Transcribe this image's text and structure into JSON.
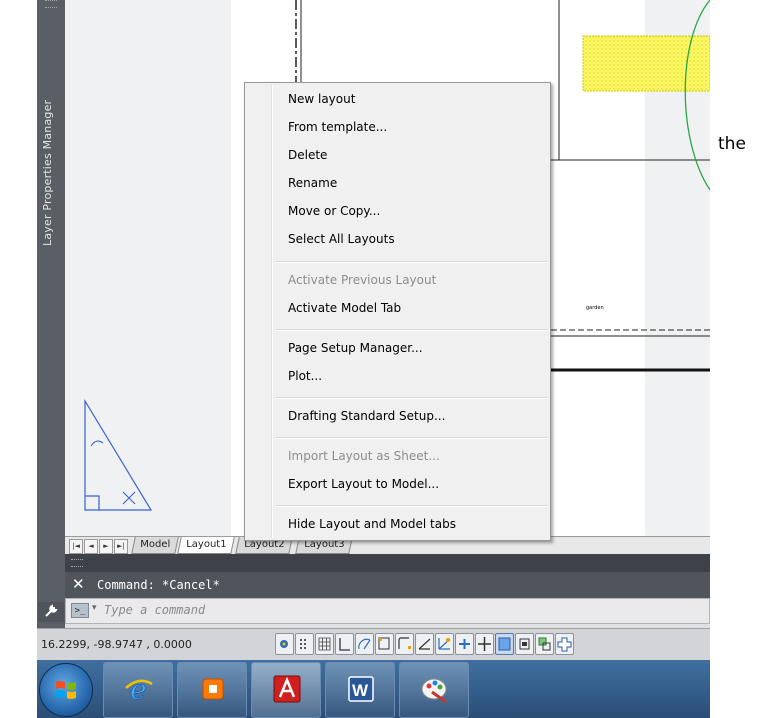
{
  "palette": {
    "title": "Layer Properties Manager"
  },
  "drawing": {
    "small_label": "garden"
  },
  "layout_tabs": {
    "nav": [
      "|◄",
      "◄",
      "►",
      "►|"
    ],
    "tabs": [
      {
        "label": "Model",
        "active": false
      },
      {
        "label": "Layout1",
        "active": true
      },
      {
        "label": "Layout2",
        "active": false
      },
      {
        "label": "Layout3",
        "active": false
      }
    ]
  },
  "command": {
    "history": "Command: *Cancel*",
    "prompt_glyph": ">_",
    "placeholder": "Type a command"
  },
  "status": {
    "coordinates": "16.2299,  -98.9747  , 0.0000"
  },
  "context_menu": {
    "items": [
      {
        "label": "New layout",
        "disabled": false
      },
      {
        "label": "From template...",
        "disabled": false
      },
      {
        "label": "Delete",
        "disabled": false
      },
      {
        "label": "Rename",
        "disabled": false
      },
      {
        "label": "Move or Copy...",
        "disabled": false
      },
      {
        "label": "Select All Layouts",
        "disabled": false
      },
      {
        "label": "Activate Previous Layout",
        "disabled": true
      },
      {
        "label": "Activate Model Tab",
        "disabled": false
      },
      {
        "label": "Page Setup Manager...",
        "disabled": false
      },
      {
        "label": "Plot...",
        "disabled": false
      },
      {
        "label": "Drafting Standard Setup...",
        "disabled": false
      },
      {
        "label": "Import Layout as Sheet...",
        "disabled": true
      },
      {
        "label": "Export Layout to Model...",
        "disabled": false
      },
      {
        "label": "Hide Layout and Model tabs",
        "disabled": false
      }
    ]
  },
  "side_text": "the",
  "icons": {
    "ucs": "ucs-icon",
    "close": "close-icon",
    "wrench": "wrench-icon",
    "start": "windows-start-icon",
    "taskbar": [
      "internet-explorer-icon",
      "media-player-icon",
      "autocad-icon",
      "word-icon",
      "paint-icon"
    ]
  },
  "colors": {
    "ucs_blue": "#3a5fd8",
    "hatch_yellow": "#f2ef3a",
    "arc_green": "#28a745",
    "taskbar": "#2f5a88"
  }
}
